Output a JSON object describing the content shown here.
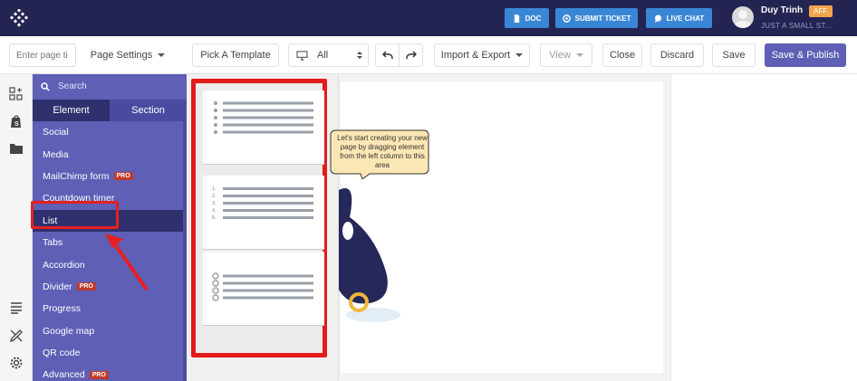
{
  "topbar": {
    "doc_label": "DOC",
    "ticket_label": "SUBMIT TICKET",
    "chat_label": "LIVE CHAT",
    "user_name": "Duy Trinh",
    "user_badge": "AFF.",
    "user_store": "JUST A SMALL ST..."
  },
  "toolbar": {
    "page_title_placeholder": "Enter page ti",
    "page_settings": "Page Settings",
    "pick_template": "Pick A Template",
    "device_select": "All",
    "import_export": "Import & Export",
    "view": "View",
    "close": "Close",
    "discard": "Discard",
    "save": "Save",
    "save_publish": "Save & Publish"
  },
  "panel": {
    "search_placeholder": "Search",
    "tabs": [
      "Element",
      "Section"
    ],
    "items": [
      {
        "label": "Social",
        "pro": ""
      },
      {
        "label": "Media",
        "pro": ""
      },
      {
        "label": "MailChimp form",
        "pro": "PRO"
      },
      {
        "label": "Countdown timer",
        "pro": ""
      },
      {
        "label": "List",
        "pro": ""
      },
      {
        "label": "Tabs",
        "pro": ""
      },
      {
        "label": "Accordion",
        "pro": ""
      },
      {
        "label": "Divider",
        "pro": "PRO"
      },
      {
        "label": "Progress",
        "pro": ""
      },
      {
        "label": "Google map",
        "pro": ""
      },
      {
        "label": "QR code",
        "pro": ""
      },
      {
        "label": "Advanced",
        "pro": "PRO"
      }
    ],
    "selected_index": 4
  },
  "preview": {
    "numbers": [
      "1.",
      "2.",
      "3.",
      "4.",
      "5."
    ]
  },
  "canvas": {
    "bubble_text": "Let's start creating your new page by dragging element from the left column to this area"
  },
  "colors": {
    "topbar": "#232452",
    "panel": "#5e5fb5",
    "selected": "#2f306d",
    "highlight": "#e21b1b",
    "help_button": "#3a86d6"
  }
}
